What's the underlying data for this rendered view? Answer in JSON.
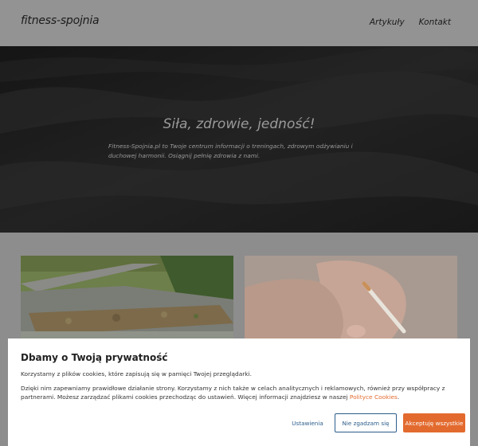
{
  "header": {
    "logo": "fitness-spojnia",
    "nav": [
      "Artykuły",
      "Kontakt"
    ]
  },
  "hero": {
    "title": "Siła, zdrowie, jedność!",
    "text": "Fitness-Spojnia.pl to Twoje centrum informacji o treningach, zdrowym odżywianiu i duchowej harmonii. Osiągnij pełnię zdrowia z nami."
  },
  "cards": {
    "left_image": "garden-roof-image",
    "right_image": "hand-cigarette-image"
  },
  "cookie": {
    "title": "Dbamy o Twoją prywatność",
    "line1": "Korzystamy z plików cookies, które zapisują się w pamięci Twojej przeglądarki.",
    "line2_prefix": "Dzięki nim zapewniamy prawidłowe działanie strony. Korzystamy z nich także w celach analitycznych i reklamowych, również przy współpracy z partnerami. Możesz zarządzać plikami cookies przechodząc do ustawień. Więcej informacji znajdziesz w naszej ",
    "policy_link": "Polityce Cookies",
    "line2_suffix": ".",
    "buttons": {
      "settings": "Ustawienia",
      "reject": "Nie zgadzam się",
      "accept": "Akceptuję wszystkie"
    }
  },
  "colors": {
    "accent": "#e36a2e",
    "link_blue": "#2c5d8a"
  }
}
